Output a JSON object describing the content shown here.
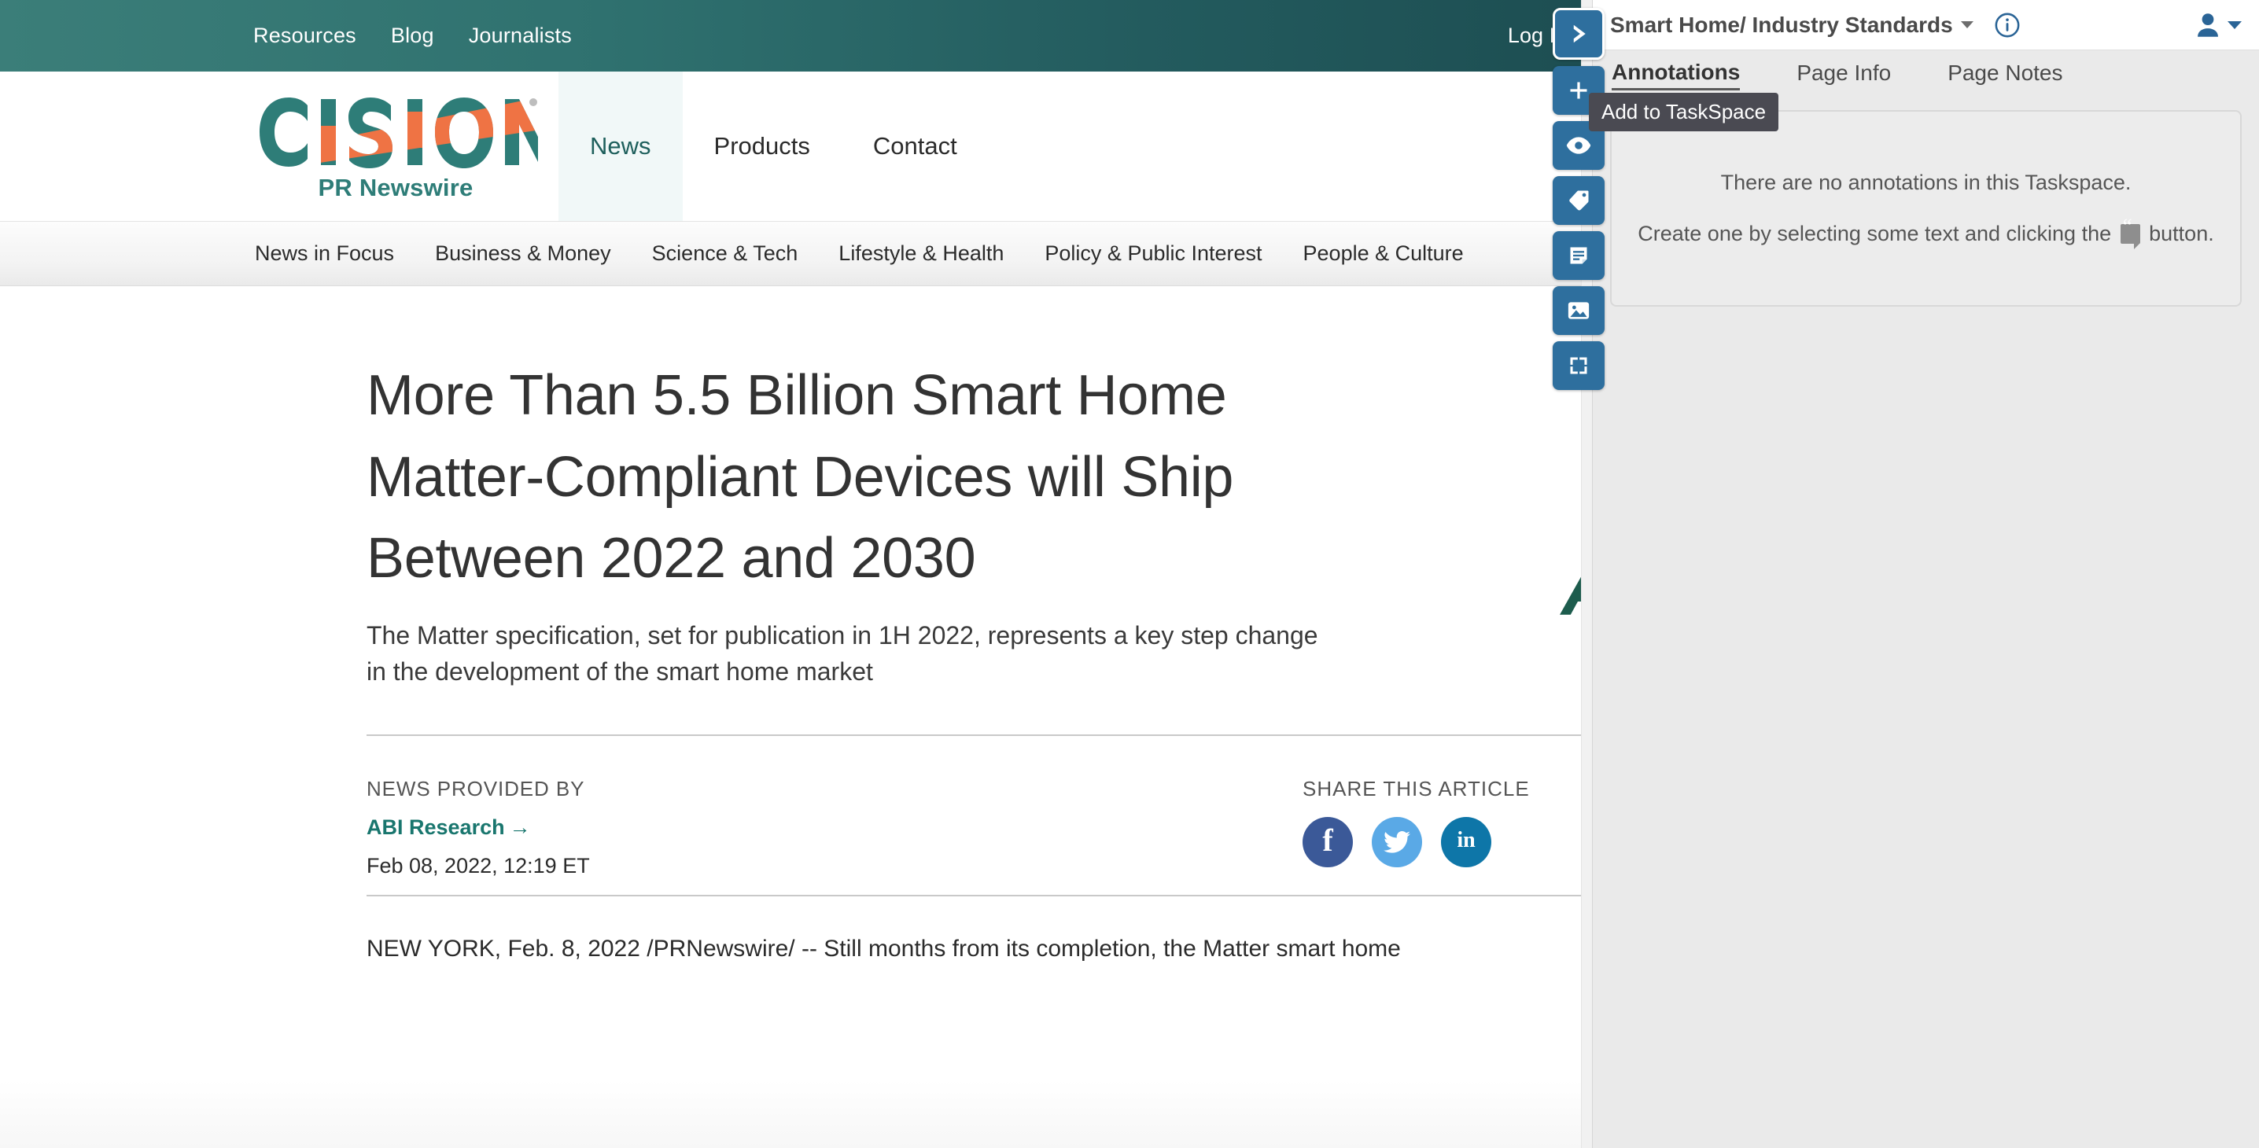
{
  "webpage": {
    "utility_nav": [
      {
        "label": "Resources"
      },
      {
        "label": "Blog"
      },
      {
        "label": "Journalists"
      }
    ],
    "login_label": "Log In",
    "brand": {
      "wordmark": "CISION",
      "tagline": "PR Newswire",
      "registered_mark": "®"
    },
    "main_nav": [
      {
        "label": "News",
        "active": true
      },
      {
        "label": "Products",
        "active": false
      },
      {
        "label": "Contact",
        "active": false
      }
    ],
    "category_nav": [
      {
        "label": "News in Focus"
      },
      {
        "label": "Business & Money"
      },
      {
        "label": "Science & Tech"
      },
      {
        "label": "Lifestyle & Health"
      },
      {
        "label": "Policy & Public Interest"
      },
      {
        "label": "People & Culture"
      }
    ],
    "article": {
      "headline": "More Than 5.5 Billion Smart Home Matter-Compliant Devices will Ship Between 2022 and 2030",
      "subhead": "The Matter specification, set for publication in 1H 2022, represents a key step change in the development of the smart home market",
      "news_provided_by_label": "NEWS PROVIDED BY",
      "provider": "ABI Research",
      "provider_arrow": "→",
      "date": "Feb 08, 2022, 12:19 ET",
      "share_label": "SHARE THIS ARTICLE",
      "share_buttons": [
        {
          "name": "facebook",
          "glyph": "f",
          "color": "#3b5998"
        },
        {
          "name": "twitter",
          "glyph": "",
          "color": "#5aa9e6"
        },
        {
          "name": "linkedin",
          "glyph": "in",
          "color": "#0e76a8"
        }
      ],
      "body_lead": "NEW YORK, Feb. 8, 2022 /PRNewswire/ -- Still months from its completion, the Matter smart home",
      "abi_logo_letter": "A"
    }
  },
  "tool_rail": [
    {
      "name": "chevron-right-icon",
      "tooltip": ""
    },
    {
      "name": "plus-icon",
      "tooltip": "Add to TaskSpace"
    },
    {
      "name": "eye-icon",
      "tooltip": ""
    },
    {
      "name": "tag-icon",
      "tooltip": ""
    },
    {
      "name": "note-icon",
      "tooltip": ""
    },
    {
      "name": "image-icon",
      "tooltip": ""
    },
    {
      "name": "fullscreen-icon",
      "tooltip": ""
    }
  ],
  "tooltip": {
    "text": "Add to TaskSpace"
  },
  "panel": {
    "taskspace_title": "Smart Home/ Industry Standards",
    "info_icon": "info-circle-icon",
    "account_icon": "user-avatar-icon",
    "tabs": [
      {
        "label": "Annotations",
        "active": true
      },
      {
        "label": "Page Info",
        "active": false
      },
      {
        "label": "Page Notes",
        "active": false
      }
    ],
    "empty_state": {
      "line1": "There are no annotations in this Taskspace.",
      "line2_before": "Create one by selecting some text and clicking the",
      "line2_after": "button.",
      "quote_icon": "quote-bubble-icon"
    }
  },
  "colors": {
    "teal_light": "#3b7e79",
    "teal_dark": "#1d4e52",
    "cision_teal": "#2e7d78",
    "cision_orange": "#ef7344",
    "panel_bg": "#eaeaea",
    "tool_blue": "#2e6f9e",
    "provider_green": "#19766e"
  }
}
